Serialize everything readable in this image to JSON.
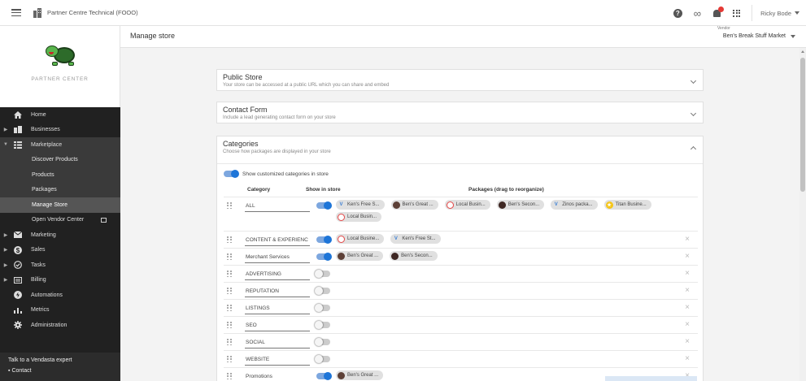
{
  "topbar": {
    "org_name": "Partner Centre Technical (FOOO)",
    "user_name": "Ricky Bode"
  },
  "sidebar": {
    "brand_label": "PARTNER CENTER",
    "nav": [
      {
        "label": "Home",
        "icon": "home-icon"
      },
      {
        "label": "Businesses",
        "icon": "building-icon"
      },
      {
        "label": "Marketplace",
        "icon": "grid-icon"
      },
      {
        "label": "Discover Products"
      },
      {
        "label": "Products"
      },
      {
        "label": "Packages"
      },
      {
        "label": "Manage Store"
      },
      {
        "label": "Open Vendor Center"
      },
      {
        "label": "Marketing",
        "icon": "mail-icon"
      },
      {
        "label": "Sales",
        "icon": "dollar-icon"
      },
      {
        "label": "Tasks",
        "icon": "check-circle-icon"
      },
      {
        "label": "Billing",
        "icon": "billing-icon"
      },
      {
        "label": "Automations",
        "icon": "automation-icon"
      },
      {
        "label": "Metrics",
        "icon": "bar-chart-icon"
      },
      {
        "label": "Administration",
        "icon": "gear-icon"
      }
    ],
    "footer": {
      "expert": "Talk to a Vendasta expert",
      "contact": "Contact"
    }
  },
  "header": {
    "title": "Manage store",
    "vendor_label": "Vendor",
    "vendor_value": "Ben's Break Stuff Market"
  },
  "panels": {
    "public_store": {
      "title": "Public Store",
      "subtitle": "Your store can be accessed at a public URL which you can share and embed"
    },
    "contact_form": {
      "title": "Contact Form",
      "subtitle": "Include a lead generating contact form on your store"
    },
    "categories": {
      "title": "Categories",
      "subtitle": "Choose how packages are displayed in your store",
      "custom_toggle_label": "Show customized categories in store",
      "col_category": "Category",
      "col_show": "Show in store",
      "col_packages": "Packages (drag to reorganize)",
      "rows": [
        {
          "name": "ALL",
          "on": true,
          "packages": [
            {
              "label": "Ken's Free S...",
              "av": "v"
            },
            {
              "label": "Ben's Great ...",
              "av": "photo"
            },
            {
              "label": "Local Busin...",
              "av": "ring"
            },
            {
              "label": "Ben's Secon...",
              "av": "photo2"
            },
            {
              "label": "Zinos packa...",
              "av": "v"
            },
            {
              "label": "Titan Busine...",
              "av": "star"
            },
            {
              "label": "Local Busin...",
              "av": "ring"
            }
          ]
        },
        {
          "name": "CONTENT & EXPERIENC",
          "on": true,
          "packages": [
            {
              "label": "Local Busine...",
              "av": "ring"
            },
            {
              "label": "Ken's Free St...",
              "av": "v"
            }
          ]
        },
        {
          "name": "Merchant Services",
          "on": true,
          "packages": [
            {
              "label": "Ben's Great ...",
              "av": "photo"
            },
            {
              "label": "Ben's Secon...",
              "av": "photo2"
            }
          ]
        },
        {
          "name": "ADVERTISING",
          "on": false,
          "packages": []
        },
        {
          "name": "REPUTATION",
          "on": false,
          "packages": []
        },
        {
          "name": "LISTINGS",
          "on": false,
          "packages": []
        },
        {
          "name": "SEO",
          "on": false,
          "packages": []
        },
        {
          "name": "SOCIAL",
          "on": false,
          "packages": []
        },
        {
          "name": "WEBSITE",
          "on": false,
          "packages": []
        },
        {
          "name": "Promotions",
          "on": true,
          "packages": [
            {
              "label": "Ben's Great ...",
              "av": "photo"
            }
          ]
        }
      ]
    }
  },
  "colors": {
    "accent": "#1e75d8",
    "sidebar_bg": "#212121",
    "active_nav": "#555555"
  }
}
